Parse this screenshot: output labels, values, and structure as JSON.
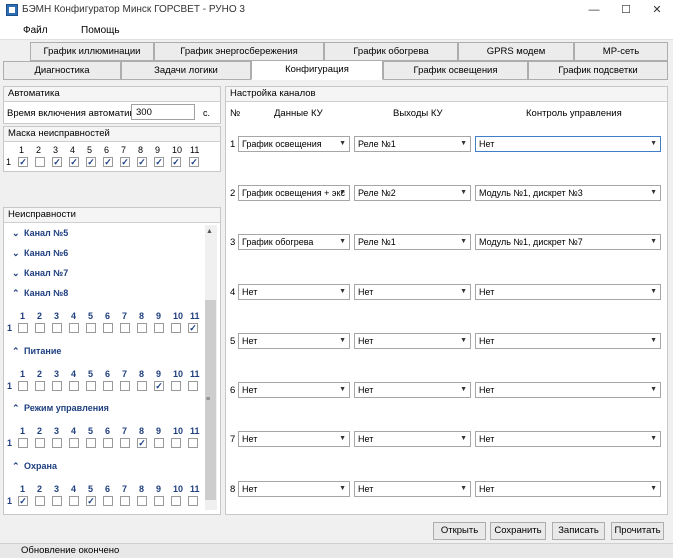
{
  "window": {
    "title": "БЭМН Конфигуратор Минск ГОРСВЕТ - РУНО 3",
    "icon": "app-icon",
    "controls": [
      "—",
      "☐",
      "✕"
    ]
  },
  "menu": {
    "items": [
      "Файл",
      "Помощь"
    ]
  },
  "tabs": {
    "row1": [
      "График иллюминации",
      "График энергосбережения",
      "График обогрева",
      "GPRS модем",
      "MP-сеть"
    ],
    "row2": [
      "Диагностика",
      "Задачи логики",
      "Конфигурация",
      "График освещения",
      "График подсветки"
    ],
    "active": "Конфигурация"
  },
  "automation": {
    "title": "Автоматика",
    "time_label": "Время включения автоматики:",
    "time_value": "300",
    "unit": "с."
  },
  "fault_mask": {
    "title": "Маска неисправностей",
    "numbers": [
      "1",
      "2",
      "3",
      "4",
      "5",
      "6",
      "7",
      "8",
      "9",
      "10",
      "11"
    ],
    "row_label": "1",
    "checked": [
      true,
      false,
      true,
      true,
      true,
      true,
      true,
      true,
      true,
      true,
      true
    ]
  },
  "faults": {
    "title": "Неисправности",
    "collapsed": [
      {
        "chev": "⌄",
        "label": "Канал №5"
      },
      {
        "chev": "⌄",
        "label": "Канал №6"
      },
      {
        "chev": "⌄",
        "label": "Канал №7"
      }
    ],
    "sections": [
      {
        "chev": "⌃",
        "label": "Канал №8",
        "row_label": "1",
        "checked": [
          false,
          false,
          false,
          false,
          false,
          false,
          false,
          false,
          false,
          false,
          true
        ]
      },
      {
        "chev": "⌃",
        "label": "Питание",
        "row_label": "1",
        "checked": [
          false,
          false,
          false,
          false,
          false,
          false,
          false,
          false,
          true,
          false,
          false
        ]
      },
      {
        "chev": "⌃",
        "label": "Режим управления",
        "row_label": "1",
        "checked": [
          false,
          false,
          false,
          false,
          false,
          false,
          false,
          true,
          false,
          false,
          false
        ]
      },
      {
        "chev": "⌃",
        "label": "Охрана",
        "row_label": "1",
        "checked": [
          true,
          false,
          false,
          false,
          true,
          false,
          false,
          false,
          false,
          false,
          false
        ]
      }
    ],
    "numbers": [
      "1",
      "2",
      "3",
      "4",
      "5",
      "6",
      "7",
      "8",
      "9",
      "10",
      "11"
    ]
  },
  "channels": {
    "title": "Настройка каналов",
    "headers": {
      "num": "№",
      "data": "Данные КУ",
      "outputs": "Выходы КУ",
      "control": "Контроль управления"
    },
    "rows": [
      {
        "num": "1",
        "data": "График освещения",
        "out": "Реле №1",
        "ctrl": "Нет"
      },
      {
        "num": "2",
        "data": "График освещения + экс",
        "out": "Реле №2",
        "ctrl": "Модуль №1, дискрет №3"
      },
      {
        "num": "3",
        "data": "График обогрева",
        "out": "Реле №1",
        "ctrl": "Модуль №1, дискрет №7"
      },
      {
        "num": "4",
        "data": "Нет",
        "out": "Нет",
        "ctrl": "Нет"
      },
      {
        "num": "5",
        "data": "Нет",
        "out": "Нет",
        "ctrl": "Нет"
      },
      {
        "num": "6",
        "data": "Нет",
        "out": "Нет",
        "ctrl": "Нет"
      },
      {
        "num": "7",
        "data": "Нет",
        "out": "Нет",
        "ctrl": "Нет"
      },
      {
        "num": "8",
        "data": "Нет",
        "out": "Нет",
        "ctrl": "Нет"
      }
    ]
  },
  "buttons": [
    "Открыть",
    "Сохранить",
    "Записать",
    "Прочитать"
  ],
  "status": "Обновление окончено"
}
